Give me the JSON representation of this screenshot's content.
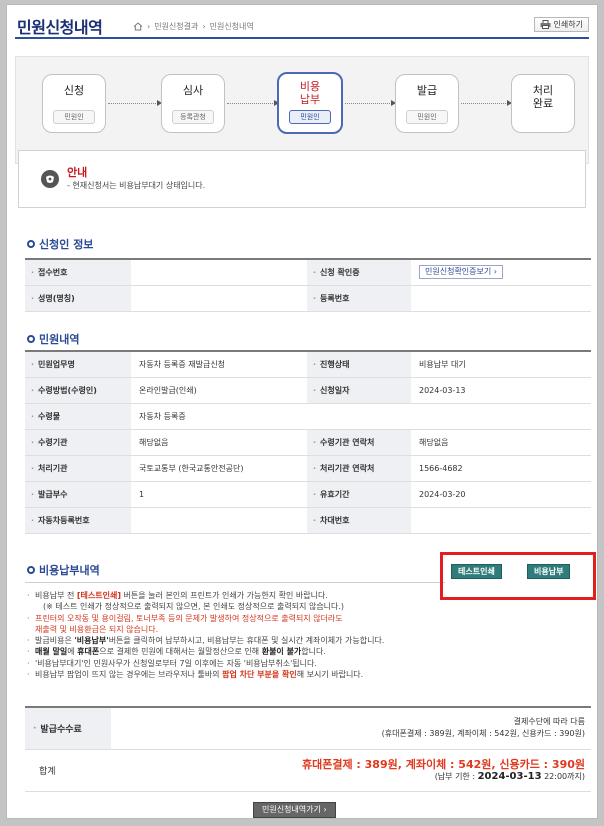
{
  "header": {
    "title": "민원신청내역",
    "breadcrumb": [
      "민원신청결과",
      "민원신청내역"
    ],
    "print_label": "인쇄하기"
  },
  "steps": [
    {
      "name": "신청",
      "sub": "민원인",
      "active": false
    },
    {
      "name": "심사",
      "sub": "등록관청",
      "active": false
    },
    {
      "name": "비용\n납부",
      "sub": "민원인",
      "active": true
    },
    {
      "name": "발급",
      "sub": "민원인",
      "active": false
    },
    {
      "name": "처리\n완료",
      "sub": "",
      "active": false
    }
  ],
  "notice": {
    "title": "안내",
    "body": "- 현재신청서는 비용납부대기 상태입니다."
  },
  "applicant": {
    "section_title": "신청인 정보",
    "receipt_no_label": "접수번호",
    "receipt_no_value": "",
    "confirm_label": "신청 확인증",
    "confirm_button": "민원신청확인증보기",
    "name_label": "성명(명칭)",
    "name_value": "",
    "reg_no_label": "등록번호",
    "reg_no_value": ""
  },
  "petition": {
    "section_title": "민원내역",
    "rows": [
      {
        "l1": "민원업무명",
        "v1": "자동차 등록증 재발급신청",
        "l2": "진행상태",
        "v2": "비용납부 대기"
      },
      {
        "l1": "수령방법(수령인)",
        "v1": "온라인발급(인쇄)",
        "l2": "신청일자",
        "v2": "2024-03-13"
      },
      {
        "l1": "수령물",
        "v1": "자동차 등록증",
        "l2": "",
        "v2": ""
      },
      {
        "l1": "수령기관",
        "v1": "해당없음",
        "l2": "수령기관 연락처",
        "v2": "해당없음"
      },
      {
        "l1": "처리기관",
        "v1": "국토교통부 (한국교통안전공단)",
        "l2": "처리기관 연락처",
        "v2": "1566-4682"
      },
      {
        "l1": "발급부수",
        "v1": "1",
        "l2": "유효기간",
        "v2": "2024-03-20"
      },
      {
        "l1": "자동차등록번호",
        "v1": "",
        "l2": "차대번호",
        "v2": ""
      }
    ]
  },
  "fee": {
    "section_title": "비용납부내역",
    "test_print_button": "테스트인쇄",
    "pay_button": "비용납부",
    "notes": {
      "n1_a": "비용납부 전 ",
      "n1_b": "[테스트인쇄]",
      "n1_c": " 버튼을 눌러 본인의 프린트가 인쇄가 가능한지 확인 바랍니다.",
      "n2": "(※ 테스트 인쇄가 정상적으로 출력되지 않으면, 본 인쇄도 정상적으로 출력되지 않습니다.)",
      "n3": "프린터의 오작동 및 용이걸림, 토너부족 등의 문제가 발생하여 정상적으로 출력되지 않더라도",
      "n4": "재출력 및 비용환급은 되지 않습니다.",
      "n5_a": "발급비용은 ",
      "n5_b": "'비용납부'",
      "n5_c": "버튼을 클릭하여 납부하시고, 비용납부는 휴대폰 및 실시간 계좌이체가 가능합니다.",
      "n6_a": "매월 말일",
      "n6_b": "에 ",
      "n6_c": "휴대폰",
      "n6_d": "으로 결제한 민원에 대해서는 월말정산으로 인해 ",
      "n6_e": "환불이 불가",
      "n6_f": "합니다.",
      "n7": "'비용납부대기'인 민원사무가 신청일로부터 7일 이후에는 자동 '비용납부취소'됩니다.",
      "n8_a": "비용납부 팝업이 뜨지 않는 경우에는 브라우저나 툴바의 ",
      "n8_b": "팝업 차단 부분을 확인",
      "n8_c": "해 보시기 바랍니다."
    },
    "fee_label": "발급수수료",
    "fee_line1": "결제수단에 따라 다름",
    "fee_line2": "(휴대폰결제 : 389원, 계좌이체 : 542원, 신용카드 : 390원)",
    "total_label": "합계",
    "total_amounts": "휴대폰결제 : 389원, 계좌이체 : 542원, 신용카드 : 390원",
    "due_prefix": "(납부 기한 : ",
    "due_date": "2024-03-13",
    "due_suffix": " 22:00까지)"
  },
  "footer": {
    "back_button": "민원신청내역가기"
  }
}
